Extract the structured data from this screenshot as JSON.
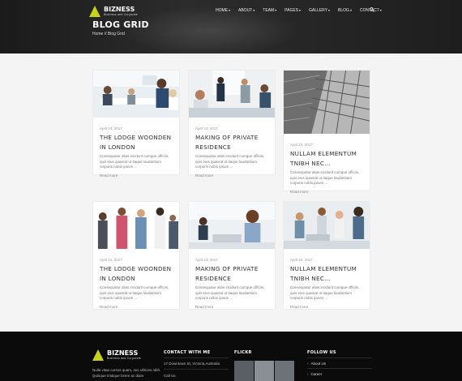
{
  "brand": {
    "name": "BIZNESS",
    "tagline": "Business and Corporate"
  },
  "nav": {
    "items": [
      {
        "label": "HOME",
        "caret": "▾"
      },
      {
        "label": "ABOUT",
        "caret": "▾"
      },
      {
        "label": "TEAM",
        "caret": "▾"
      },
      {
        "label": "PAGES",
        "caret": "▾"
      },
      {
        "label": "GALLERY",
        "caret": "▾"
      },
      {
        "label": "BLOG",
        "caret": "▾"
      },
      {
        "label": "CONTACT",
        "caret": "▾"
      }
    ],
    "search_icon": "search-icon"
  },
  "hero": {
    "title": "BLOG GRID",
    "breadcrumb": "Home // Blog Grid"
  },
  "posts": [
    {
      "date": "April 24, 2017",
      "title": "THE LODGE WOONDEN IN LONDON",
      "excerpt": "Consequatur alias incidunt cumque officiis, quis eius quaerat ut itaque laudantium corporis nobis ipsum ...",
      "more": "Read more",
      "image": "office-meeting"
    },
    {
      "date": "April 24, 2017",
      "title": "MAKING OF PRIVATE RESIDENCE",
      "excerpt": "Consequatur alias incidunt cumque officiis, quis eius quaerat ut itaque laudantium corporis nobis ipsum ...",
      "more": "Read more",
      "image": "team-discussion"
    },
    {
      "date": "April 24, 2017",
      "title": "NULLAM ELEMENTUM TNIBH NEC...",
      "excerpt": "Consequatur alias incidunt cumque officiis, quis eius quaerat ut itaque laudantium corporis nobis ipsum ...",
      "more": "Read more",
      "image": "skyscraper"
    },
    {
      "date": "April 24, 2017",
      "title": "THE LODGE WOONDEN IN LONDON",
      "excerpt": "Consequatur alias incidunt cumque officiis, quis eius quaerat ut itaque laudantium corporis nobis ipsum ...",
      "more": "Read more",
      "image": "team-portrait"
    },
    {
      "date": "April 24, 2017",
      "title": "MAKING OF PRIVATE RESIDENCE",
      "excerpt": "Consequatur alias incidunt cumque officiis, quis eius quaerat ut itaque laudantium corporis nobis ipsum ...",
      "more": "Read more",
      "image": "laptop-woman"
    },
    {
      "date": "April 24, 2017",
      "title": "NULLAM ELEMENTUM TNIBH NEC...",
      "excerpt": "Consequatur alias incidunt cumque officiis, quis eius quaerat ut itaque laudantium corporis nobis ipsum ...",
      "more": "Read more",
      "image": "group-laptop"
    }
  ],
  "footer": {
    "desc": "Nulla vitae cursus quam, nec ultrices nibh. Quisque tristique lorem ac diam",
    "contact_heading": "CONTACT WITH ME",
    "address": "17 Downtown St, Victoria,Australia",
    "call_label": "Call Us",
    "flickr_heading": "FLICKR",
    "follow_heading": "FOLLOW US",
    "follow_links": [
      "About Us",
      "Career"
    ]
  },
  "colors": {
    "accent": "#c7d21a",
    "dark": "#0b0b0b"
  }
}
